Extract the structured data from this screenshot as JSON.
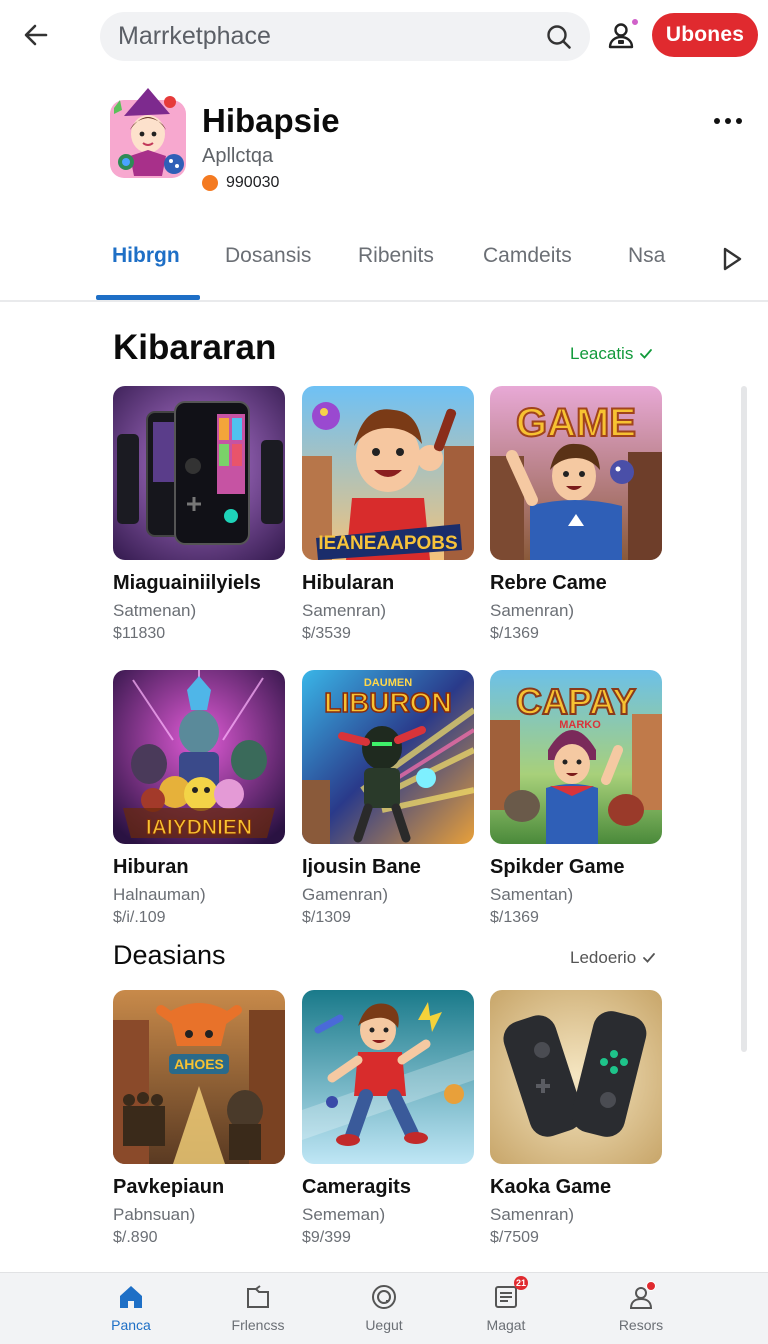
{
  "search": {
    "placeholder": "Marrketphace"
  },
  "header": {
    "cta_label": "Ubones"
  },
  "app": {
    "name": "Hibapsie",
    "subtitle": "Apllctqa",
    "stat": "990030"
  },
  "tabs": [
    {
      "label": "Hibrgn",
      "active": true
    },
    {
      "label": "Dosansis"
    },
    {
      "label": "Ribenits"
    },
    {
      "label": "Camdeits"
    },
    {
      "label": "Nsa"
    }
  ],
  "sections": [
    {
      "title": "Kibararan",
      "link": "Leacatis",
      "items": [
        {
          "title": "Miaguainiilyiels",
          "subtitle": "Satmenan)",
          "price": "$11830"
        },
        {
          "title": "Hibularan",
          "subtitle": "Samenran)",
          "price": "$/3539"
        },
        {
          "title": "Rebre Came",
          "subtitle": "Samenran)",
          "price": "$/1369"
        },
        {
          "title": "Hiburan",
          "subtitle": "Halnauman)",
          "price": "$/i/.109"
        },
        {
          "title": "Ijousin Bane",
          "subtitle": "Gamenran)",
          "price": "$/1309"
        },
        {
          "title": "Spikder Game",
          "subtitle": "Samentan)",
          "price": "$/1369"
        }
      ]
    },
    {
      "title": "Deasians",
      "link": "Ledoerio",
      "items": [
        {
          "title": "Pavkepiaun",
          "subtitle": "Pabnsuan)",
          "price": "$/.890"
        },
        {
          "title": "Cameragits",
          "subtitle": "Sememan)",
          "price": "$9/399"
        },
        {
          "title": "Kaoka Game",
          "subtitle": "Samenran)",
          "price": "$/7509"
        }
      ]
    }
  ],
  "thumb_text": {
    "t2": "IEANEAAPOBS",
    "t3": "GAME",
    "t4": "IAIYDNIEN",
    "t5a": "DAUMEN",
    "t5b": "LIBURON",
    "t6a": "CAPAY",
    "t6b": "MARKO",
    "t7": "AHOES"
  },
  "bottom_nav": [
    {
      "label": "Panca",
      "icon": "home-icon",
      "active": true
    },
    {
      "label": "Frlencss",
      "icon": "folder-icon"
    },
    {
      "label": "Uegut",
      "icon": "coin-icon"
    },
    {
      "label": "Magat",
      "icon": "list-icon",
      "badge": "21"
    },
    {
      "label": "Resors",
      "icon": "profile-icon"
    }
  ],
  "colors": {
    "accent": "#1e6fc6",
    "cta": "#e02a2f",
    "link_green": "#129a3b",
    "stat_dot": "#f47a21"
  }
}
